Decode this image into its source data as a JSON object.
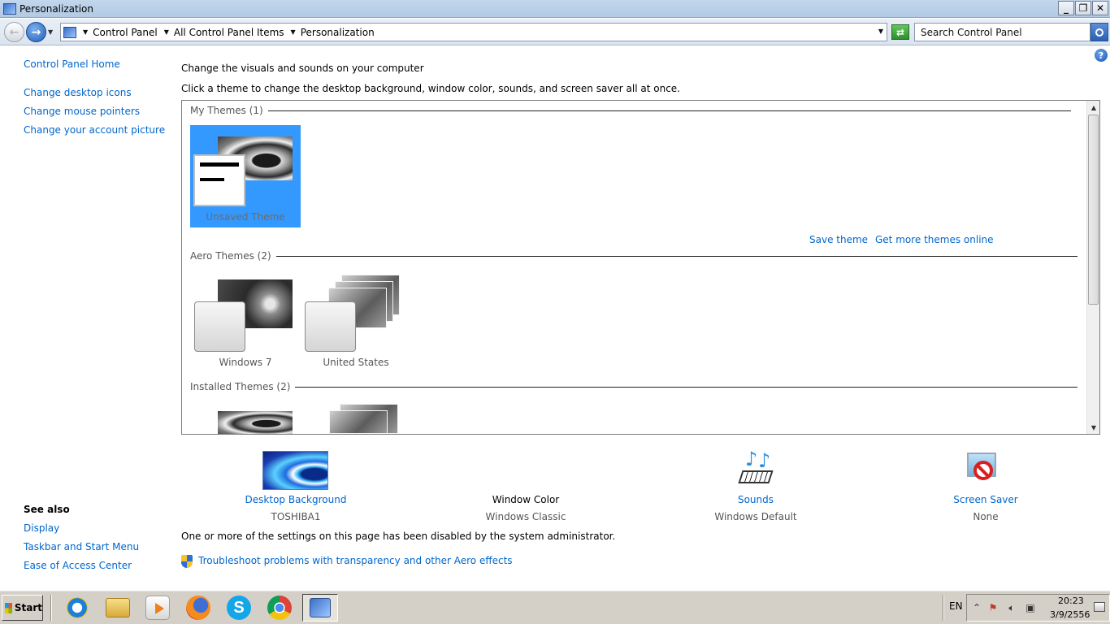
{
  "window": {
    "title": "Personalization",
    "minimize": "_",
    "maximize": "❐",
    "close": "✕"
  },
  "address": {
    "breadcrumbs": [
      "Control Panel",
      "All Control Panel Items",
      "Personalization"
    ],
    "search_placeholder": "Search Control Panel"
  },
  "sidebar": {
    "home": "Control Panel Home",
    "links": [
      "Change desktop icons",
      "Change mouse pointers",
      "Change your account picture"
    ],
    "see_also_title": "See also",
    "see_also": [
      "Display",
      "Taskbar and Start Menu",
      "Ease of Access Center"
    ]
  },
  "main": {
    "heading": "Change the visuals and sounds on your computer",
    "subheading": "Click a theme to change the desktop background, window color, sounds, and screen saver all at once.",
    "groups": {
      "my_themes": "My Themes (1)",
      "aero_themes": "Aero Themes (2)",
      "installed_themes": "Installed Themes (2)"
    },
    "themes": {
      "unsaved": "Unsaved Theme",
      "windows7": "Windows 7",
      "united_states": "United States"
    },
    "save_theme": "Save theme",
    "get_more": "Get more themes online"
  },
  "settings": {
    "desktop_background": {
      "title": "Desktop Background",
      "value": "TOSHIBA1"
    },
    "window_color": {
      "title": "Window Color",
      "value": "Windows Classic"
    },
    "sounds": {
      "title": "Sounds",
      "value": "Windows Default"
    },
    "screen_saver": {
      "title": "Screen Saver",
      "value": "None"
    }
  },
  "disabled_note": "One or more of the settings on this page has been disabled by the system administrator.",
  "troubleshoot": "Troubleshoot problems with transparency and other Aero effects",
  "taskbar": {
    "start": "Start",
    "language": "EN",
    "time": "20:23",
    "date": "3/9/2556"
  }
}
